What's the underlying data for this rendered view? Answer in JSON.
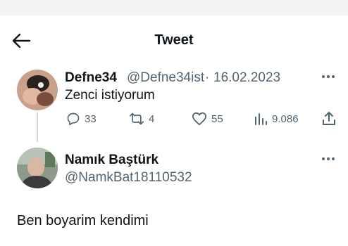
{
  "header": {
    "title": "Tweet"
  },
  "tweet": {
    "display_name": "Defne34",
    "handle": "@Defne34ist",
    "separator": "·",
    "date": "16.02.2023",
    "text": "Zenci istiyorum",
    "stats": {
      "replies": "33",
      "retweets": "4",
      "likes": "55",
      "views": "9.086"
    }
  },
  "reply": {
    "display_name": "Namık Baştürk",
    "handle": "@NamkBat18110532",
    "text": "Ben boyarim kendimi"
  },
  "icons": [
    "back-arrow-icon",
    "more-icon",
    "reply-icon",
    "retweet-icon",
    "like-icon",
    "views-icon",
    "share-icon"
  ],
  "colors": {
    "muted": "#536471",
    "text": "#0f1419",
    "divider": "#cfd9de"
  }
}
